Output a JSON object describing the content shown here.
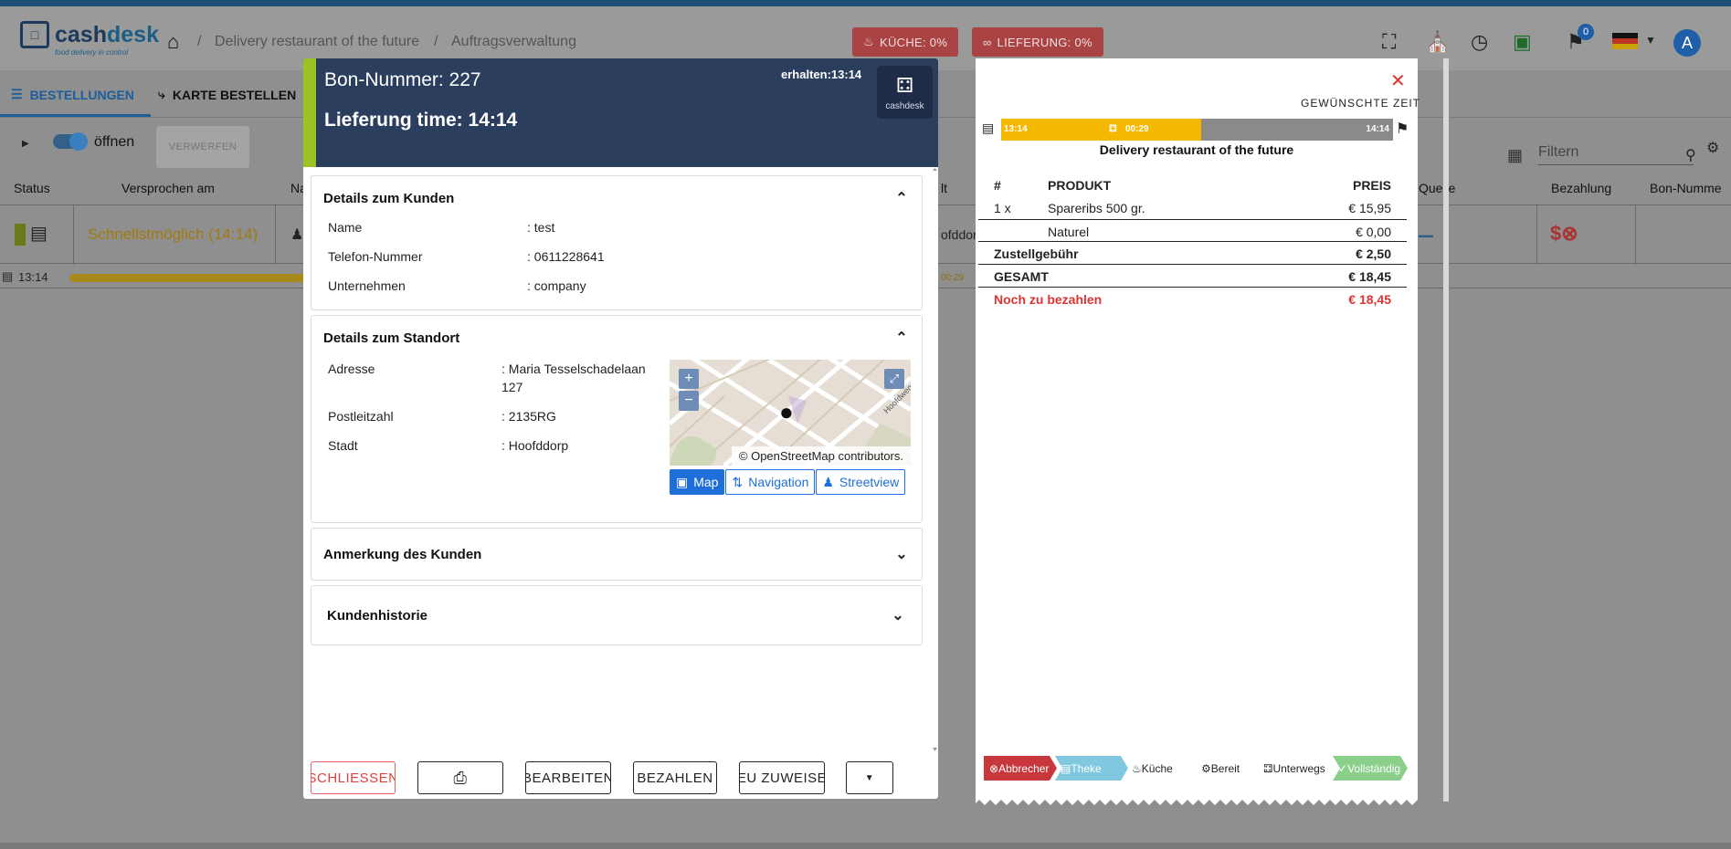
{
  "header": {
    "logo_text_a": "cash",
    "logo_text_b": "desk",
    "logo_sub": "food delivery in control",
    "breadcrumbs": [
      "Delivery restaurant of the future",
      "Auftragsverwaltung"
    ],
    "kitchen_pill": "KÜCHE: 0%",
    "delivery_pill": "LIEFERUNG: 0%",
    "notifications": "0",
    "avatar": "A"
  },
  "tabs": {
    "orders": "BESTELLUNGEN",
    "map_orders": "KARTE BESTELLEN"
  },
  "filters": {
    "toggle_label": "öffnen",
    "discard_label": "VERWERFEN",
    "filter_placeholder": "Filtern"
  },
  "table": {
    "columns": [
      "Status",
      "Versprochen am",
      "Na",
      "lt",
      "Quelle",
      "Bezahlung",
      "Bon-Numme"
    ],
    "row": {
      "promised": "Schnellstmöglich (14:14)",
      "city_fragment": "ofddorp",
      "time": "13:14",
      "bar_label": "00:29"
    }
  },
  "order": {
    "bon_number": "Bon-Nummer: 227",
    "delivery_time": "Lieferung time: 14:14",
    "received": "erhalten:13:14",
    "logo_label": "cashdesk",
    "customer": {
      "title": "Details zum Kunden",
      "fields": [
        {
          "label": "Name",
          "value": ": test"
        },
        {
          "label": "Telefon-Nummer",
          "value": ": 0611228641"
        },
        {
          "label": "Unternehmen",
          "value": ": company"
        }
      ]
    },
    "location": {
      "title": "Details zum Standort",
      "fields": [
        {
          "label": "Adresse",
          "value": ": Maria Tesselschadelaan 127"
        },
        {
          "label": "Postleitzahl",
          "value": ": 2135RG"
        },
        {
          "label": "Stadt",
          "value": ": Hoofddorp"
        }
      ],
      "map_attribution": "© OpenStreetMap contributors.",
      "map_street": "Hoofdweg",
      "map_buttons": [
        "Map",
        "Navigation",
        "Streetview"
      ]
    },
    "customer_note": {
      "title": "Anmerkung des Kunden"
    },
    "customer_history": {
      "title": "Kundenhistorie"
    },
    "footer_buttons": {
      "close": "SCHLIESSEN",
      "edit": "BEARBEITEN",
      "pay": "BEZAHLEN",
      "assign": "EU ZUWEISE"
    }
  },
  "receipt": {
    "wish_time": "GEWÜNSCHTE ZEIT",
    "timeline": {
      "start": "13:14",
      "elapsed": "00:29",
      "end": "14:14"
    },
    "store": "Delivery restaurant of the future",
    "columns": {
      "num": "#",
      "product": "PRODUKT",
      "price": "PREIS"
    },
    "items": [
      {
        "qty": "1 x",
        "name": "Spareribs 500 gr.",
        "price": "€ 15,95"
      },
      {
        "qty": "",
        "name": "Naturel",
        "price": "€ 0,00"
      }
    ],
    "delivery_fee": {
      "label": "Zustellgebühr",
      "value": "€ 2,50"
    },
    "total": {
      "label": "GESAMT",
      "value": "€ 18,45"
    },
    "due": {
      "label": "Noch zu bezahlen",
      "value": "€ 18,45"
    },
    "steps": [
      "Abbrecher",
      "Theke",
      "Küche",
      "Bereit",
      "Unterwegs",
      "Vollständig"
    ]
  },
  "colors": {
    "header_bg": "#2c3e5e",
    "accent_green": "#9cc223",
    "primary_blue": "#1e6fd9",
    "danger_red": "#d33333",
    "timeline_yellow": "#f5b800"
  }
}
